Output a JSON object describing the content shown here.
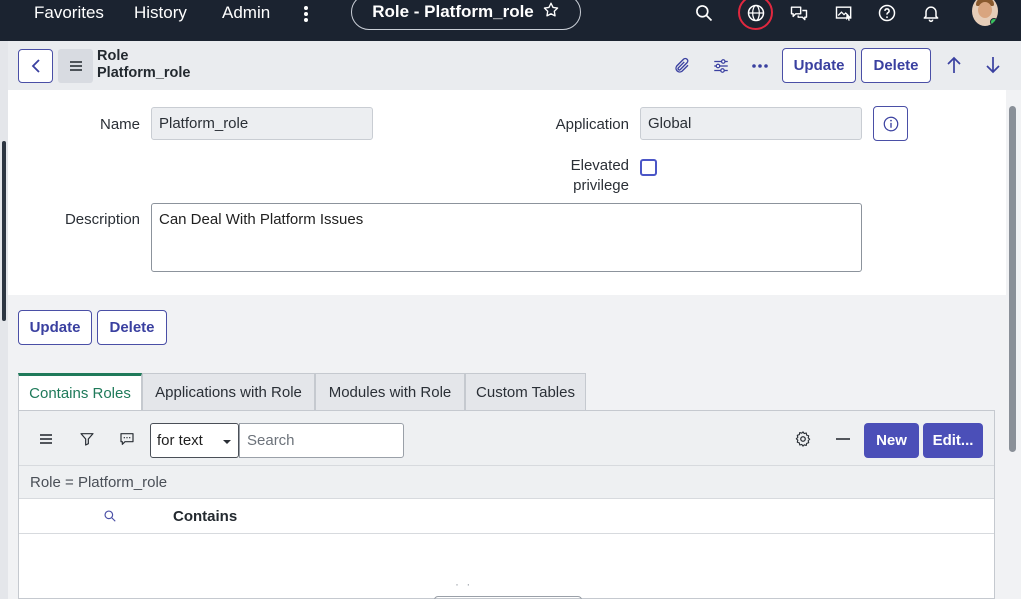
{
  "topnav": {
    "links": [
      "Favorites",
      "History",
      "Admin"
    ],
    "context_title": "Role - Platform_role",
    "icons": [
      "more-vertical-icon",
      "star-icon",
      "search-icon",
      "globe-icon",
      "chat-icon",
      "screenshot-icon",
      "help-icon",
      "bell-icon",
      "avatar"
    ]
  },
  "form_header": {
    "title_line1": "Role",
    "title_line2": "Platform_role",
    "update_label": "Update",
    "delete_label": "Delete",
    "icons": [
      "back-icon",
      "menu-icon",
      "attachment-icon",
      "settings-sliders-icon",
      "more-horizontal-icon",
      "arrow-up-icon",
      "arrow-down-icon"
    ]
  },
  "form": {
    "name_label": "Name",
    "name_value": "Platform_role",
    "application_label": "Application",
    "application_value": "Global",
    "elevated_label_line1": "Elevated",
    "elevated_label_line2": "privilege",
    "elevated_checked": false,
    "description_label": "Description",
    "description_value": "Can Deal With Platform Issues"
  },
  "form_buttons": {
    "update_label": "Update",
    "delete_label": "Delete"
  },
  "tabs": [
    {
      "label": "Contains Roles",
      "active": true
    },
    {
      "label": "Applications with Role",
      "active": false
    },
    {
      "label": "Modules with Role",
      "active": false
    },
    {
      "label": "Custom Tables",
      "active": false
    }
  ],
  "list": {
    "search_field_option": "for text",
    "search_placeholder": "Search",
    "new_label": "New",
    "edit_label": "Edit...",
    "filter_breadcrumb": "Role = Platform_role",
    "column_header": "Contains"
  },
  "colors": {
    "nav_bg": "#1b2330",
    "accent": "#4b4fb8",
    "active_tab": "#1f7a5a",
    "globe_ring": "#e0283f"
  }
}
